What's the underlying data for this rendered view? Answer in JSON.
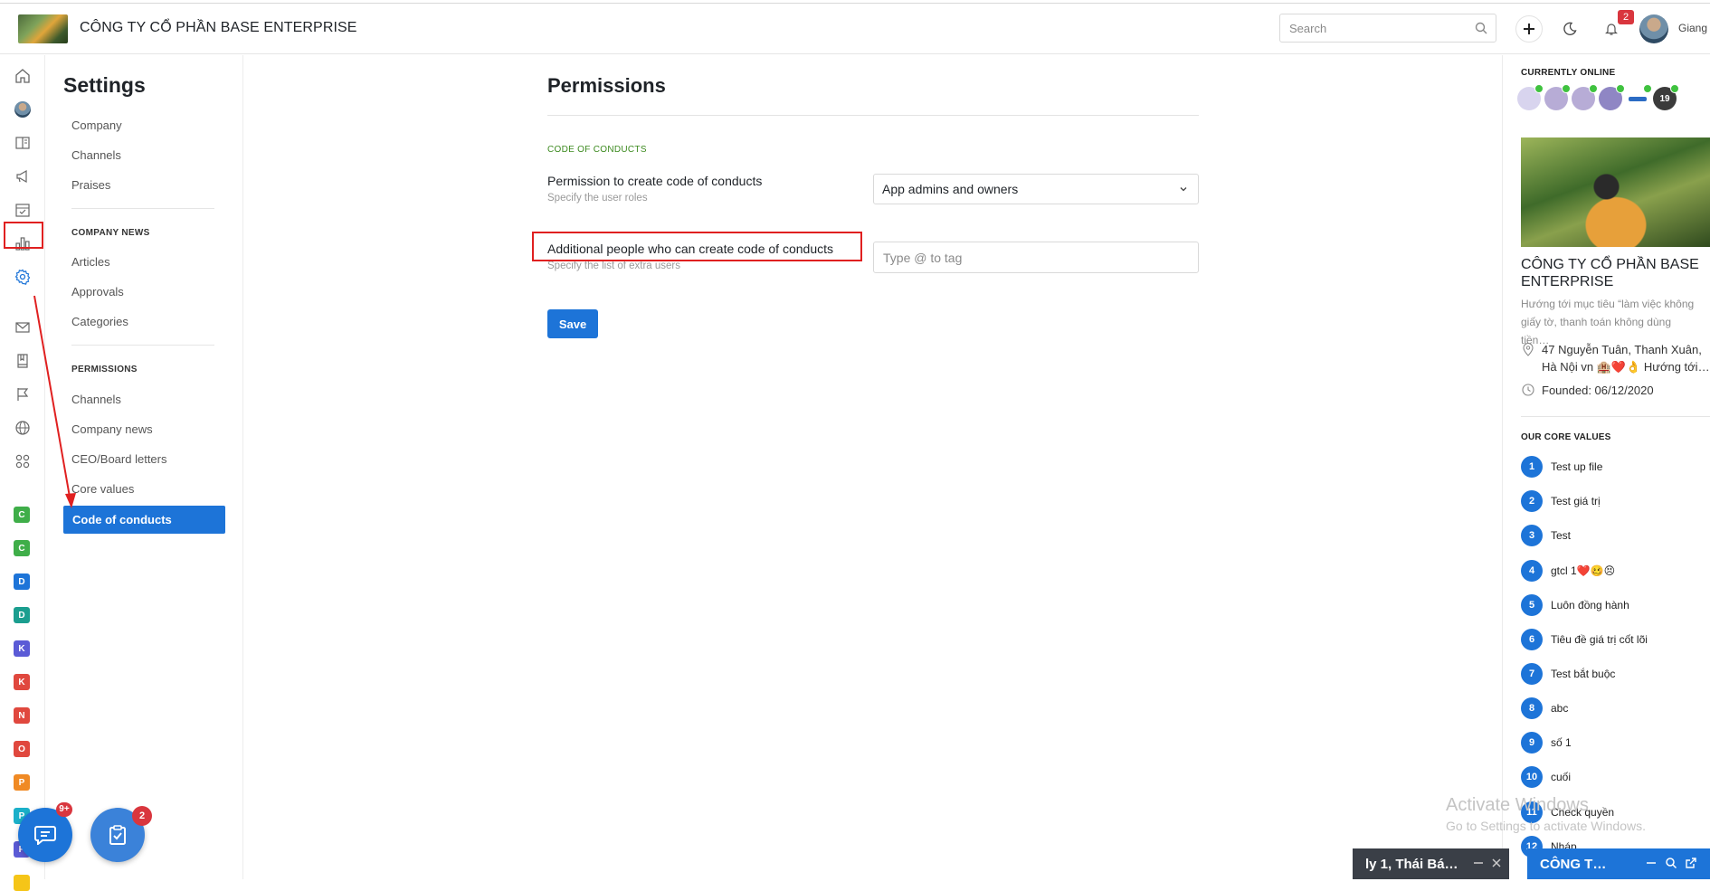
{
  "header": {
    "company_name": "CÔNG TY CỔ PHẦN BASE ENTERPRISE",
    "search_placeholder": "Search",
    "notification_count": "2",
    "username": "Giang"
  },
  "rail": {
    "icons": [
      "home-icon",
      "profile-avatar",
      "newsfeed-icon",
      "announcement-icon",
      "calendar-check-icon",
      "chart-icon",
      "settings-icon",
      "mail-icon",
      "book-icon",
      "flag-icon",
      "globe-icon",
      "apps-icon"
    ],
    "letters": [
      {
        "letter": "C",
        "color": "#3fae49"
      },
      {
        "letter": "C",
        "color": "#3fae49"
      },
      {
        "letter": "D",
        "color": "#1d74d8"
      },
      {
        "letter": "D",
        "color": "#1b9e8f"
      },
      {
        "letter": "K",
        "color": "#5b5bd6"
      },
      {
        "letter": "K",
        "color": "#e0483e"
      },
      {
        "letter": "N",
        "color": "#e0483e"
      },
      {
        "letter": "O",
        "color": "#e0483e"
      },
      {
        "letter": "P",
        "color": "#f08a24"
      },
      {
        "letter": "P",
        "color": "#1bb0c9"
      },
      {
        "letter": "P",
        "color": "#5b5bd6"
      }
    ]
  },
  "sidebar": {
    "title": "Settings",
    "group1": [
      "Company",
      "Channels",
      "Praises"
    ],
    "section2": "COMPANY NEWS",
    "group2": [
      "Articles",
      "Approvals",
      "Categories"
    ],
    "section3": "PERMISSIONS",
    "group3": [
      "Channels",
      "Company news",
      "CEO/Board letters",
      "Core values"
    ],
    "active_item": "Code of conducts"
  },
  "main": {
    "title": "Permissions",
    "section_label": "CODE OF CONDUCTS",
    "field1_label": "Permission to create code of conducts",
    "field1_hint": "Specify the user roles",
    "field1_value": "App admins and owners",
    "field2_label": "Additional people who can create code of conducts",
    "field2_hint": "Specify the list of extra users",
    "field2_placeholder": "Type @ to tag",
    "save_label": "Save"
  },
  "right_panel": {
    "online_label": "CURRENTLY ONLINE",
    "online_extra_count": "19",
    "company_name": "CÔNG TY CỔ PHẦN BASE ENTERPRISE",
    "description": "Hướng tới mục tiêu “làm việc không giấy tờ, thanh toán không dùng tiền…",
    "address": "47 Nguyễn Tuân, Thanh Xuân, Hà Nội vn 🏨❤️👌 Hướng tới…",
    "founded": "Founded: 06/12/2020",
    "core_values_label": "OUR CORE VALUES",
    "core_values": [
      {
        "num": "1",
        "text": "Test up file"
      },
      {
        "num": "2",
        "text": "Test giá trị"
      },
      {
        "num": "3",
        "text": "Test"
      },
      {
        "num": "4",
        "text": "gtcl 1❤️🥴😣"
      },
      {
        "num": "5",
        "text": "Luôn đồng hành"
      },
      {
        "num": "6",
        "text": "Tiêu đề giá trị cốt lõi"
      },
      {
        "num": "7",
        "text": "Test bắt buộc"
      },
      {
        "num": "8",
        "text": "abc"
      },
      {
        "num": "9",
        "text": "số 1"
      },
      {
        "num": "10",
        "text": "cuối"
      },
      {
        "num": "11",
        "text": "Check quyền"
      },
      {
        "num": "12",
        "text": "Nháp"
      }
    ]
  },
  "watermark": {
    "line1": "Activate Windows",
    "line2": "Go to Settings to activate Windows."
  },
  "chat_tabs": {
    "tab1": "ly 1, Thái Bá…",
    "tab2": "CÔNG T…"
  },
  "floating": {
    "chat_badge": "9+",
    "tasks_badge": "2"
  }
}
